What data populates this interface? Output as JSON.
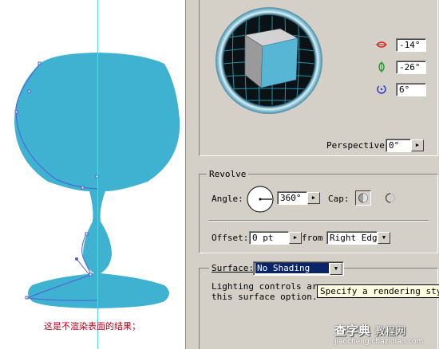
{
  "canvas": {
    "caption": "这是不渲染表面的结果；"
  },
  "colors": {
    "glass_fill": "#3fb2d2",
    "guide": "#4fd8e6",
    "path": "#4d5fd6",
    "caption": "#c0001a",
    "panel_bg": "#d4d0c8"
  },
  "rotation": {
    "x_value": "-14°",
    "y_value": "-26°",
    "z_value": "6°",
    "perspective_label": "Perspective:",
    "perspective_value": "0°"
  },
  "revolve": {
    "group_label": "Revolve",
    "angle_label": "Angle:",
    "angle_value": "360°",
    "cap_label": "Cap:",
    "offset_label": "Offset:",
    "offset_value": "0 pt",
    "from_label": "from",
    "from_value": "Right Edge"
  },
  "surface": {
    "label": "Surface:",
    "value": "No Shading",
    "info_text_1": "Lighting controls are",
    "info_text_2": "this surface option.",
    "tooltip": "Specify a rendering style"
  },
  "watermark": {
    "text_main": "查字典",
    "text_sub": "教程网",
    "url": "jiaocheng.chazidian.com"
  },
  "icons": {
    "rotate_x": "rotate-x-icon",
    "rotate_y": "rotate-y-icon",
    "rotate_z": "rotate-z-icon",
    "dropdown": "triangle-down-icon",
    "cap_on": "cap-on-icon",
    "cap_off": "cap-off-icon"
  }
}
